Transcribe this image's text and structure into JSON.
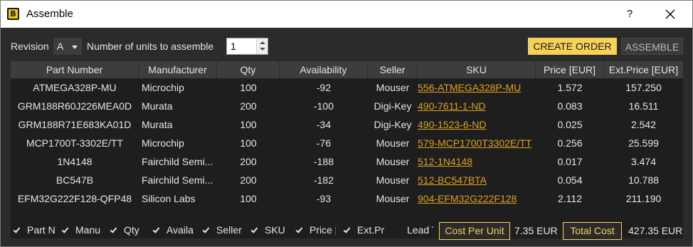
{
  "window": {
    "title": "Assemble",
    "help": "?",
    "icon_letter": "B"
  },
  "toolbar": {
    "revision_label": "Revision",
    "revision_value": "A",
    "units_label": "Number of units to assemble",
    "units_value": "1",
    "create_order_label": "CREATE ORDER",
    "assemble_label": "ASSEMBLE"
  },
  "table": {
    "headers": [
      "Part Number",
      "Manufacturer",
      "Qty",
      "Availability",
      "Seller",
      "SKU",
      "Price [EUR]",
      "Ext.Price [EUR]"
    ],
    "rows": [
      [
        "ATMEGA328P-MU",
        "Microchip",
        "100",
        "-92",
        "Mouser",
        "556-ATMEGA328P-MU",
        "1.572",
        "157.250"
      ],
      [
        "GRM188R60J226MEA0D",
        "Murata",
        "200",
        "-100",
        "Digi-Key",
        "490-7611-1-ND",
        "0.083",
        "16.511"
      ],
      [
        "GRM188R71E683KA01D",
        "Murata",
        "100",
        "-34",
        "Digi-Key",
        "490-1523-6-ND",
        "0.025",
        "2.542"
      ],
      [
        "MCP1700T-3302E/TT",
        "Microchip",
        "100",
        "-76",
        "Mouser",
        "579-MCP1700T3302E/TT",
        "0.256",
        "25.599"
      ],
      [
        "1N4148",
        "Fairchild Semi...",
        "200",
        "-188",
        "Mouser",
        "512-1N4148",
        "0.017",
        "3.474"
      ],
      [
        "BC547B",
        "Fairchild Semi...",
        "200",
        "-182",
        "Mouser",
        "512-BC547BTA",
        "0.054",
        "10.788"
      ],
      [
        "EFM32G222F128-QFP48",
        "Silicon Labs",
        "100",
        "-93",
        "Mouser",
        "904-EFM32G222F128",
        "2.112",
        "211.190"
      ]
    ]
  },
  "columns_toggles": [
    {
      "label": "Part N",
      "checked": true
    },
    {
      "label": "Manu",
      "checked": true
    },
    {
      "label": "Qty",
      "checked": true
    },
    {
      "label": "Availa",
      "checked": true
    },
    {
      "label": "Seller",
      "checked": true
    },
    {
      "label": "SKU",
      "checked": true
    },
    {
      "label": "Price [",
      "checked": true
    },
    {
      "label": "Ext.Pr",
      "checked": true
    },
    {
      "label": "Lead T",
      "checked": false
    }
  ],
  "costs": {
    "per_unit_label": "Cost Per Unit",
    "per_unit_value": "7.35 EUR",
    "total_label": "Total Cost",
    "total_value": "427.35 EUR"
  },
  "colors": {
    "accent": "#f7d158",
    "link": "#e0a020",
    "background": "#2b2b2b",
    "table_bg": "#1e1e1e",
    "header_bg": "#3d3d3d"
  },
  "icons": {
    "app": "app-logo-icon",
    "close": "close-icon",
    "dropdown": "chevron-down-icon",
    "spin_up": "spin-up-icon",
    "spin_down": "spin-down-icon",
    "checkbox": "checkmark-icon"
  }
}
